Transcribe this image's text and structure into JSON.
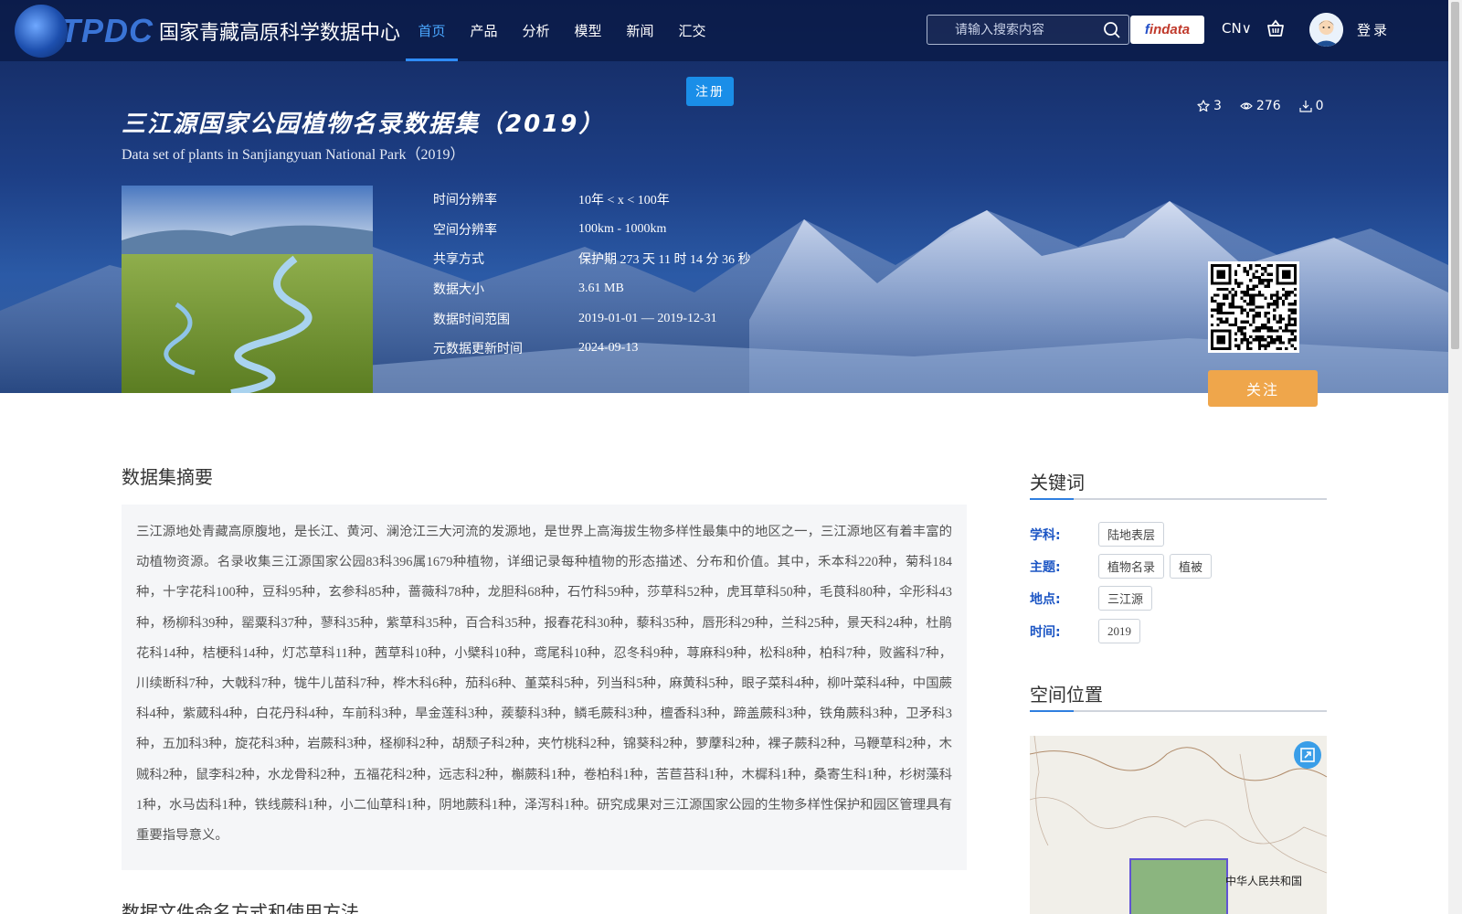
{
  "header": {
    "logo_text": "TPDC",
    "logo_cn": "国家青藏高原科学数据中心",
    "nav": [
      {
        "label": "首页",
        "active": true
      },
      {
        "label": "产品"
      },
      {
        "label": "分析"
      },
      {
        "label": "模型"
      },
      {
        "label": "新闻"
      },
      {
        "label": "汇交"
      }
    ],
    "search_placeholder": "请输入搜索内容",
    "findata_f": "f",
    "findata_rest": "indata",
    "lang": "CN∨",
    "login": "登录",
    "register": "注册"
  },
  "dataset": {
    "title_cn": "三江源国家公园植物名录数据集（2019）",
    "title_en": "Data set of plants in Sanjiangyuan National Park（2019）",
    "stats": {
      "stars": "3",
      "views": "276",
      "downloads": "0"
    },
    "meta": [
      {
        "key": "时间分辨率",
        "value": "10年 < x < 100年"
      },
      {
        "key": "空间分辨率",
        "value": "100km - 1000km"
      },
      {
        "key": "共享方式",
        "value": "保护期 273 天 11 时 14 分 36 秒"
      },
      {
        "key": "数据大小",
        "value": "3.61 MB"
      },
      {
        "key": "数据时间范围",
        "value": "2019-01-01 — 2019-12-31"
      },
      {
        "key": "元数据更新时间",
        "value": "2024-09-13"
      }
    ],
    "follow": "关注"
  },
  "abstract": {
    "title": "数据集摘要",
    "text": "三江源地处青藏高原腹地，是长江、黄河、澜沧江三大河流的发源地，是世界上高海拔生物多样性最集中的地区之一，三江源地区有着丰富的动植物资源。名录收集三江源国家公园83科396属1679种植物，详细记录每种植物的形态描述、分布和价值。其中，禾本科220种，菊科184种，十字花科100种，豆科95种，玄参科85种，蔷薇科78种，龙胆科68种，石竹科59种，莎草科52种，虎耳草科50种，毛茛科80种，伞形科43种，杨柳科39种，罂粟科37种，蓼科35种，紫草科35种，百合科35种，报春花科30种，藜科35种，唇形科29种，兰科25种，景天科24种，杜鹃花科14种，桔梗科14种，灯芯草科11种，茜草科10种，小檗科10种，鸢尾科10种，忍冬科9种，荨麻科9种，松科8种，柏科7种，败酱科7种，川续断科7种，大戟科7种，牻牛儿苗科7种，桦木科6种，茄科6种、堇菜科5种，列当科5种，麻黄科5种，眼子菜科4种，柳叶菜科4种，中国蕨科4种，紫葳科4种，白花丹科4种，车前科3种，旱金莲科3种，蒺藜科3种，鳞毛蕨科3种，檀香科3种，蹄盖蕨科3种，铁角蕨科3种，卫矛科3种，五加科3种，旋花科3种，岩蕨科3种，柽柳科2种，胡颓子科2种，夹竹桃科2种，锦葵科2种，萝藦科2种，裸子蕨科2种，马鞭草科2种，木贼科2种，鼠李科2种，水龙骨科2种，五福花科2种，远志科2种，槲蕨科1种，卷柏科1种，苦苣苔科1种，木樨科1种，桑寄生科1种，杉树藻科1种，水马齿科1种，铁线蕨科1种，小二仙草科1种，阴地蕨科1种，泽泻科1种。研究成果对三江源国家公园的生物多样性保护和园区管理具有重要指导意义。",
    "next_title": "数据文件命名方式和使用方法"
  },
  "keywords": {
    "title": "关键词",
    "rows": [
      {
        "label": "学科:",
        "tags": [
          "陆地表层"
        ]
      },
      {
        "label": "主题:",
        "tags": [
          "植物名录",
          "植被"
        ]
      },
      {
        "label": "地点:",
        "tags": [
          "三江源"
        ]
      },
      {
        "label": "时间:",
        "tags": [
          "2019"
        ]
      }
    ]
  },
  "location": {
    "title": "空间位置",
    "map_label": "中华人民共和国"
  },
  "colors": {
    "accent": "#2f8cff",
    "follow": "#efa64b",
    "register": "#1a8ee8",
    "keyword_label": "#1b55c4"
  }
}
